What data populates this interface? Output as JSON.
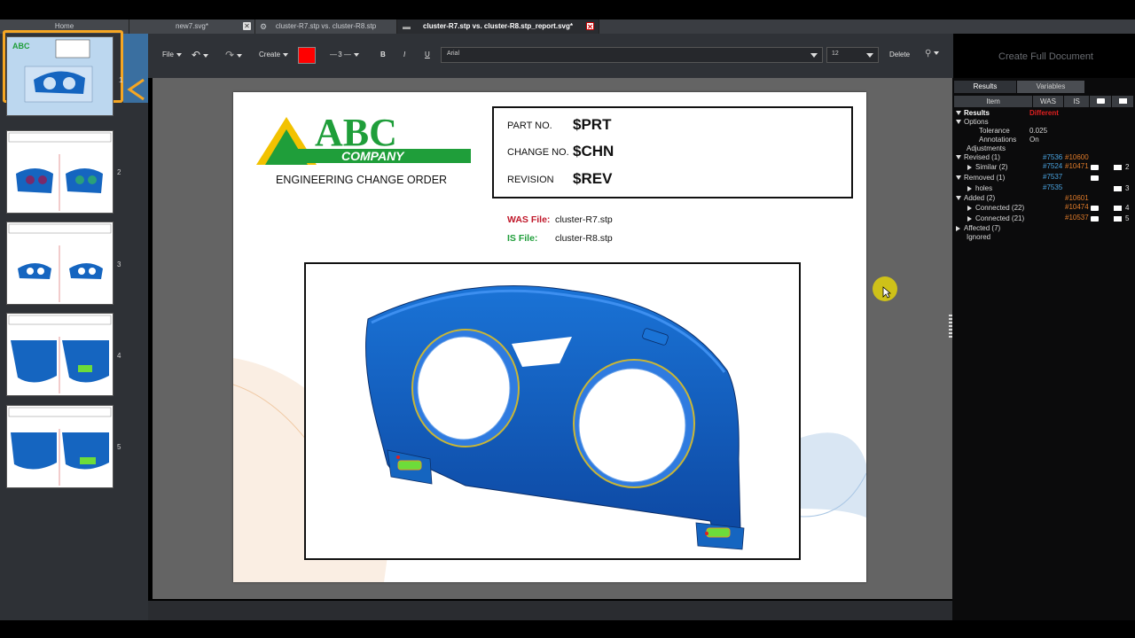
{
  "tabs": [
    {
      "label": "Home"
    },
    {
      "label": "new7.svg*"
    },
    {
      "label": "cluster-R7.stp vs. cluster-R8.stp"
    },
    {
      "label": "cluster-R7.stp vs. cluster-R8.stp_report.svg*"
    }
  ],
  "thumbnails": [
    {
      "number": "1",
      "selected": true
    },
    {
      "number": "2"
    },
    {
      "number": "3"
    },
    {
      "number": "4"
    },
    {
      "number": "5"
    }
  ],
  "toolbar": {
    "file_label": "File",
    "create_label": "Create",
    "color_swatch": "#ff0000",
    "line_width": "3",
    "bold_label": "B",
    "italic_label": "I",
    "underline_label": "U",
    "font_family": "Arial",
    "font_size": "12",
    "delete_label": "Delete",
    "create_full_document": "Create Full Document"
  },
  "page": {
    "logo_main": "ABC",
    "logo_sub": "COMPANY",
    "eco_title": "ENGINEERING CHANGE ORDER",
    "part_no_label": "PART NO.",
    "part_no_value": "$PRT",
    "change_no_label": "CHANGE NO.",
    "change_no_value": "$CHN",
    "revision_label": "REVISION",
    "revision_value": "$REV",
    "was_file_label": "WAS File:",
    "was_file_value": "cluster-R7.stp",
    "is_file_label": "IS File:",
    "is_file_value": "cluster-R8.stp"
  },
  "right_panel": {
    "tab_results": "Results",
    "tab_variables": "Variables",
    "col_item": "Item",
    "col_was": "WAS",
    "col_is": "IS",
    "rows": {
      "results": "Results",
      "results_status": "Different",
      "options": "Options",
      "tolerance": "Tolerance",
      "tolerance_value": "0.025",
      "annotations": "Annotations",
      "annotations_value": "On",
      "adjustments": "Adjustments",
      "revised": "Revised (1)",
      "revised_was": "#7536",
      "revised_is": "#10600",
      "similar": "Similar (2)",
      "similar_was": "#7524",
      "similar_is": "#10471",
      "similar_count": "2",
      "removed": "Removed (1)",
      "removed_was": "#7537",
      "holes": "holes",
      "holes_was": "#7535",
      "holes_count": "3",
      "added": "Added (2)",
      "added_is": "#10601",
      "connected22": "Connected (22)",
      "connected22_is": "#10474",
      "connected22_count": "4",
      "connected21": "Connected (21)",
      "connected21_is": "#10537",
      "connected21_count": "5",
      "affected": "Affected (7)",
      "ignored": "Ignored"
    }
  },
  "colors": {
    "selection_highlight": "#f5a623",
    "part_blue": "#1565c0",
    "logo_green": "#1f9e3a",
    "logo_yellow": "#f2c200"
  }
}
